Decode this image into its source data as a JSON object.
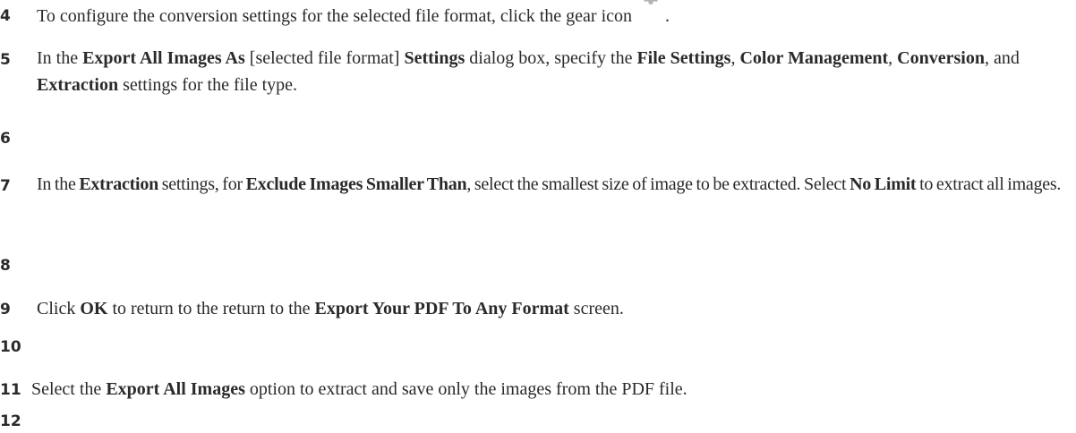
{
  "steps": [
    {
      "number": "4",
      "segments": [
        {
          "text": "To configure the conversion settings for the selected file format, click the gear icon",
          "bold": false
        },
        {
          "text": " .",
          "bold": false
        }
      ],
      "has_gear_icon": true
    },
    {
      "number": "5",
      "segments": [
        {
          "text": "In the ",
          "bold": false
        },
        {
          "text": "Export All Images As",
          "bold": true
        },
        {
          "text": " [selected file format] ",
          "bold": false
        },
        {
          "text": "Settings",
          "bold": true
        },
        {
          "text": " dialog box, specify the ",
          "bold": false
        },
        {
          "text": "File Settings",
          "bold": true
        },
        {
          "text": ", ",
          "bold": false
        },
        {
          "text": "Color Management",
          "bold": true
        },
        {
          "text": ", ",
          "bold": false
        },
        {
          "text": "Conversion",
          "bold": true
        },
        {
          "text": ", and ",
          "bold": false
        },
        {
          "text": "Extraction",
          "bold": true
        },
        {
          "text": " settings for the file type.",
          "bold": false
        }
      ]
    },
    {
      "number": "6",
      "segments": []
    },
    {
      "number": "7",
      "segments": [
        {
          "text": "In the ",
          "bold": false
        },
        {
          "text": "Extraction",
          "bold": true
        },
        {
          "text": " settings, for ",
          "bold": false
        },
        {
          "text": "Exclude Images Smaller Than",
          "bold": true
        },
        {
          "text": ", select the smallest size of image to be extracted. Select ",
          "bold": false
        },
        {
          "text": "No Limit",
          "bold": true
        },
        {
          "text": " to extract all images.",
          "bold": false
        }
      ]
    },
    {
      "number": "8",
      "segments": []
    },
    {
      "number": "9",
      "segments": [
        {
          "text": "Click ",
          "bold": false
        },
        {
          "text": "OK",
          "bold": true
        },
        {
          "text": " to return to the return to the ",
          "bold": false
        },
        {
          "text": "Export Your PDF To Any Format",
          "bold": true
        },
        {
          "text": " screen.",
          "bold": false
        }
      ]
    },
    {
      "number": "10",
      "segments": []
    },
    {
      "number": "11",
      "segments": [
        {
          "text": "Select the ",
          "bold": false
        },
        {
          "text": "Export All Images",
          "bold": true
        },
        {
          "text": " option to extract and save only the images from the PDF file.",
          "bold": false
        }
      ]
    },
    {
      "number": "12",
      "segments": []
    }
  ],
  "icons": {
    "gear": "gear-icon",
    "gear_color": "#b3b3b3"
  }
}
